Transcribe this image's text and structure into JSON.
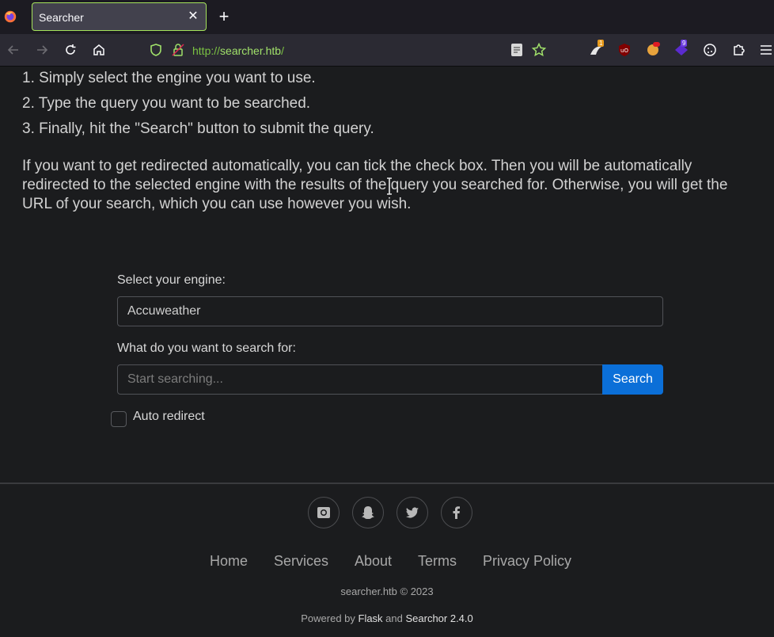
{
  "browser": {
    "tab_title": "Searcher",
    "url_scheme": "http://",
    "url_host": "searcher.htb",
    "url_path": "/",
    "ext_badges": [
      "1",
      "9"
    ]
  },
  "page": {
    "steps": [
      "1. Simply select the engine you want to use.",
      "2. Type the query you want to be searched.",
      "3. Finally, hit the \"Search\" button to submit the query."
    ],
    "paragraph": "If you want to get redirected automatically, you can tick the check box. Then you will be automatically redirected to the selected engine with the results of the query you searched for. Otherwise, you will get the URL of your search, which you can use however you wish.",
    "form": {
      "engine_label": "Select your engine:",
      "engine_value": "Accuweather",
      "query_label": "What do you want to search for:",
      "query_placeholder": "Start searching...",
      "search_button": "Search",
      "auto_redirect_label": "Auto redirect"
    }
  },
  "footer": {
    "social_icons": [
      "instagram-icon",
      "snapchat-icon",
      "twitter-icon",
      "facebook-icon"
    ],
    "links": [
      "Home",
      "Services",
      "About",
      "Terms",
      "Privacy Policy"
    ],
    "copyright": "searcher.htb © 2023",
    "powered_prefix": "Powered by ",
    "powered_flask": "Flask",
    "powered_and": " and ",
    "powered_searchor": "Searchor 2.4.0"
  }
}
